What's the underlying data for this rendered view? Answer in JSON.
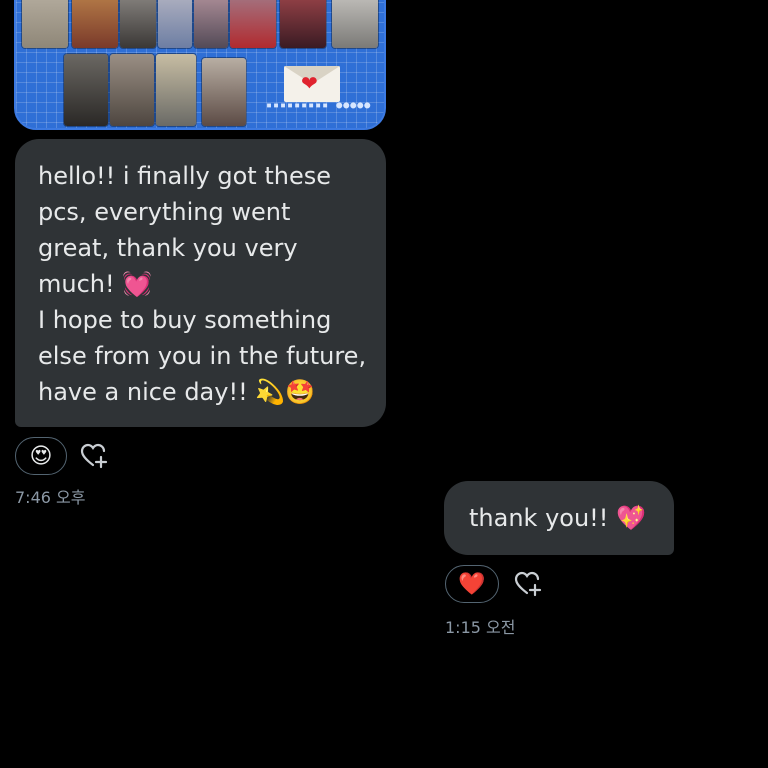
{
  "received": {
    "lines": [
      "hello!! i finally got these",
      "pcs, everything went",
      "great, thank you very",
      "much! 💓",
      "I hope to buy something",
      "else from you in the future,",
      "have a nice day!! 💫🤩"
    ],
    "reaction": "😍",
    "timestamp": "7:46 오후"
  },
  "sent": {
    "text": "thank you!! 💖",
    "reaction": "❤️",
    "timestamp": "1:15 오전"
  },
  "image": {
    "envelope_symbol": "❤",
    "dots": "▪▪▪▪▪▪▪▪▪ ●●●●●"
  },
  "colors": {
    "background": "#000000",
    "bubble": "#2f3336",
    "text": "#e7e9ea",
    "muted": "#8b98a5",
    "image_board": "#2f6fd6"
  },
  "icons": {
    "add_reaction": "heart-plus-icon"
  }
}
